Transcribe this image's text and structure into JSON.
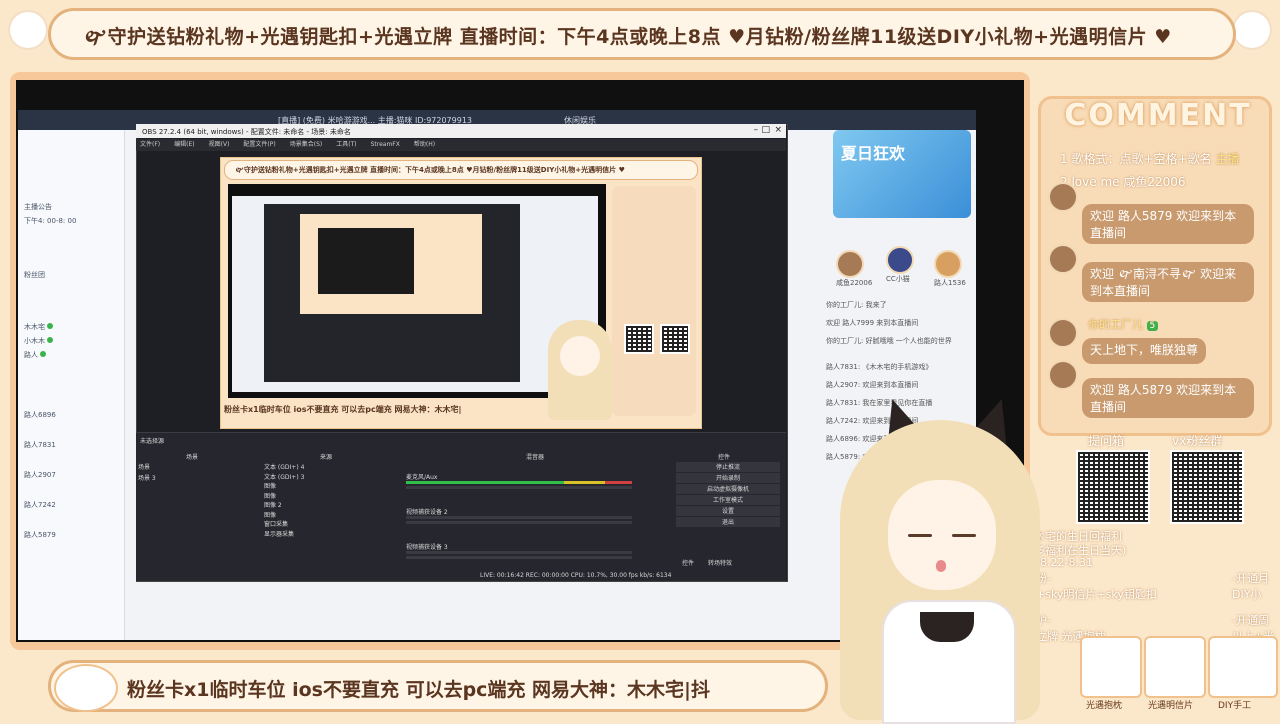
{
  "top_banner": {
    "ticker": "🙰守护送钻粉礼物+光遇钥匙扣+光遇立牌 直播时间：下午4点或晚上8点 ♥月钻粉/粉丝牌11级送DIY小礼物+光遇明信片 ♥"
  },
  "desktop": {
    "tabs": [
      "[直播] (免费)  米哈游游戏... 主播:猫咪 ID:972079913",
      "休闲娱乐"
    ],
    "left_panel_rows": [
      "主播公告",
      "下午4: 00-8: 00",
      "粉丝团",
      "木木宅",
      "小木木",
      "路人",
      "路人6896",
      "路人7831",
      "路人2907",
      "路人7242",
      "路人5879"
    ]
  },
  "obs": {
    "title": "OBS 27.2.4 (64 bit, windows) - 配置文件: 未命名 - 场景: 未命名",
    "menu": [
      "文件(F)",
      "编辑(E)",
      "视图(V)",
      "配置文件(P)",
      "场景集合(S)",
      "工具(T)",
      "StreamFX",
      "帮助(H)"
    ],
    "preview_ticker": "🙰守护送钻粉礼物+光遇钥匙扣+光遇立牌 直播时间：下午4点或晚上8点 ♥月钻粉/粉丝牌11级送DIY小礼物+光遇明信片 ♥",
    "preview_bottom": "粉丝卡x1临时车位  ios不要直充 可以去pc端充   网易大神：木木宅|",
    "scene_header": "场景",
    "sources_header": "来源",
    "mixer_header": "混音器",
    "controls_header": "控件",
    "scenes": [
      "场景",
      "场景 3"
    ],
    "sources": [
      "文本 (GDI+) 4",
      "文本 (GDI+) 3",
      "图像",
      "图像",
      "图像 2",
      "图像",
      "窗口采集",
      "显示器采集"
    ],
    "mixer": [
      "麦克风/Aux",
      "视频捕获设备 2",
      "视频捕获设备 3"
    ],
    "controls": [
      "停止推流",
      "开始录制",
      "启动虚拟摄像机",
      "工作室模式",
      "设置",
      "退出"
    ],
    "status": "LIVE: 00:16:42   REC: 00:00:00   CPU: 10.7%, 30.00 fps   kb/s: 6134",
    "transition": "转场特效"
  },
  "comment_panel": {
    "title": "COMMENT",
    "lines": [
      {
        "rank": "1",
        "text": "歌格式：点歌+空格+歌名",
        "tag": "主播"
      },
      {
        "rank": "2",
        "text": "love me 咸鱼22006",
        "tag": ""
      }
    ],
    "bubbles": [
      "欢迎 路人5879 欢迎来到本直播间",
      "欢迎 🙰南浔不寻🙰 欢迎来到本直播间",
      "天上地下，唯朕独尊",
      "欢迎 路人5879 欢迎来到本直播间"
    ],
    "fan_tag": "你的工厂儿",
    "fan_level": "5"
  },
  "qr_section": {
    "left_label": "提问箱",
    "right_label": "vx粉丝群"
  },
  "birthday": {
    "line1": "木宅的生日回福利",
    "line2": "多福利在生日当天)",
    "line3": "8.22-8.31",
    "line4": "粉-",
    "line5": "+sky明信片+sky钥匙扣",
    "line6": "护-",
    "line7": "立牌 光遇抱枕",
    "right1": "-开通月",
    "right2": "DIY小",
    "right3": "-开通周",
    "right4": "以上+光"
  },
  "bottom_banner": {
    "text": "粉丝卡x1临时车位   ios不要直充 可以去pc端充    网易大神：木木宅|抖"
  },
  "prizes": {
    "labels": [
      "光遇抱枕",
      "光遇明信片",
      "DIY手工"
    ]
  },
  "right_desk": {
    "banner_text": "夏日狂欢",
    "names": [
      "咸鱼22006",
      "CC小猫",
      "路人1536"
    ],
    "feed": [
      "你的工厂儿: 我来了",
      "欢迎 路人7999 来到本直播间",
      "你的工厂儿: 好腻哦哦 一个人也能的世界",
      "路人7831: 《木木宅的手机游戏》",
      "路人2907: 欢迎来到本直播间",
      "路人7831: 我在家里看见你在直播",
      "路人7242: 欢迎来到本直播间",
      "路人6896: 欢迎来到本直播间",
      "路人5879: 欢迎来到本直播间"
    ]
  },
  "colors": {
    "banner_bg": "#fff5e6",
    "banner_border": "#e3b27d",
    "banner_text": "#5a3520",
    "comment_panel_bg": "#f8dcb8",
    "bubble_bg": "#c89a6e",
    "obs_bg": "#1e1f24"
  }
}
